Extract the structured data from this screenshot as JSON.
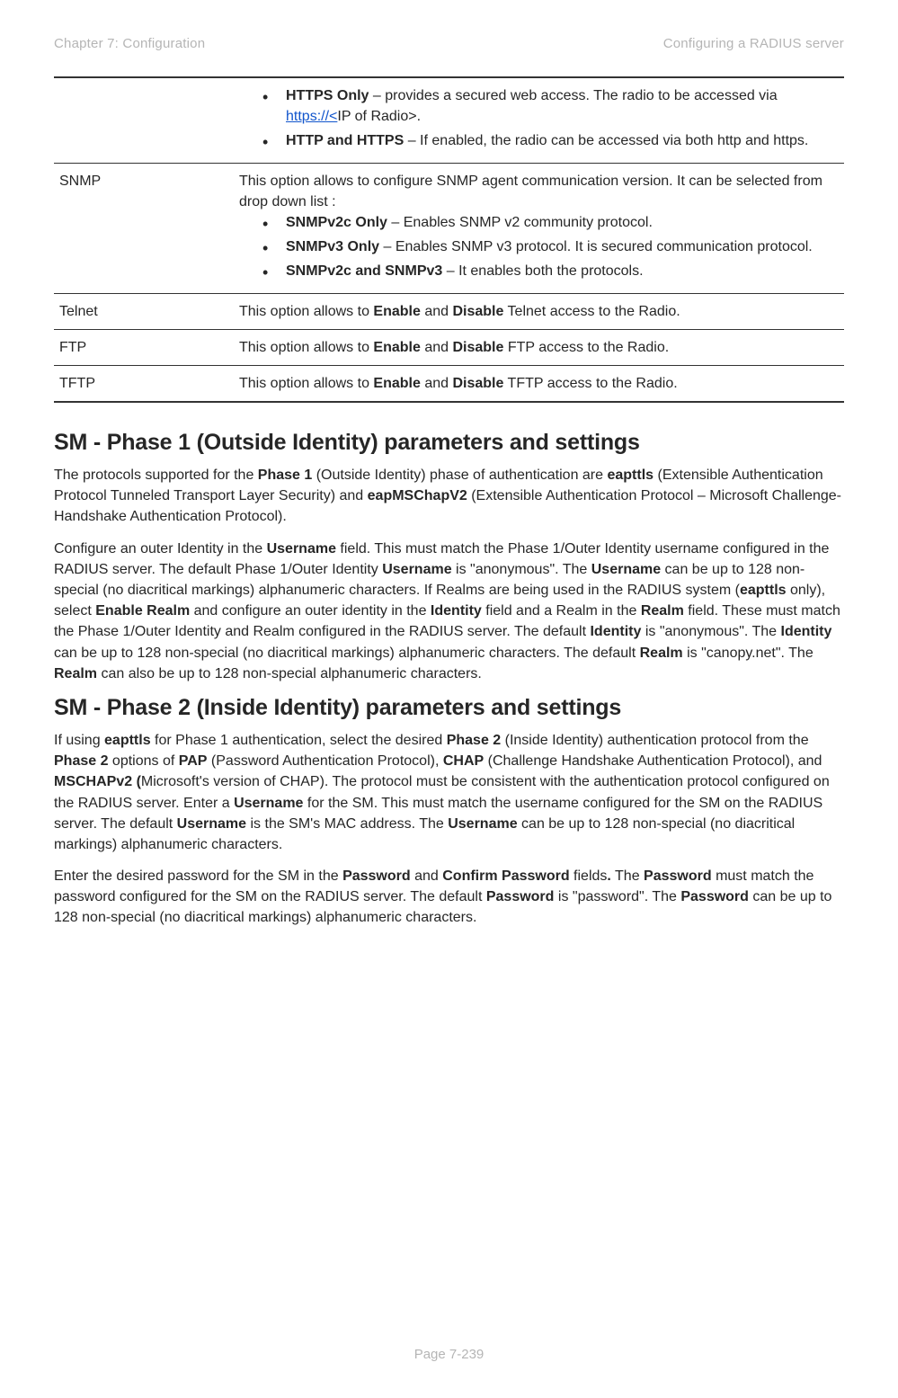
{
  "header": {
    "left": "Chapter 7:  Configuration",
    "right": "Configuring a RADIUS server"
  },
  "table": {
    "row0": {
      "b1_bold": "HTTPS Only",
      "b1_text1": " – provides a secured web access. The radio to be accessed via ",
      "b1_link": "https://<",
      "b1_text2": "IP of Radio>.",
      "b2_bold": "HTTP and HTTPS",
      "b2_text": " – If enabled, the radio can be accessed via both http and https."
    },
    "row1": {
      "label": "SNMP",
      "intro": "This option allows to configure SNMP agent communication version. It can be selected from drop down list :",
      "b1_bold": "SNMPv2c Only",
      "b1_text": " – Enables SNMP v2 community protocol.",
      "b2_bold": "SNMPv3 Only",
      "b2_text": " – Enables SNMP v3 protocol. It is secured communication protocol.",
      "b3_bold": "SNMPv2c and SNMPv3",
      "b3_text": " – It enables both the protocols."
    },
    "row2": {
      "label": "Telnet",
      "t1": "This option allows to ",
      "b1": "Enable",
      "t2": " and ",
      "b2": "Disable",
      "t3": " Telnet access to the Radio."
    },
    "row3": {
      "label": "FTP",
      "t1": "This option allows to ",
      "b1": "Enable",
      "t2": " and ",
      "b2": "Disable",
      "t3": " FTP access to the Radio."
    },
    "row4": {
      "label": "TFTP",
      "t1": "This option allows to ",
      "b1": "Enable",
      "t2": " and ",
      "b2": "Disable",
      "t3": " TFTP access to the Radio."
    }
  },
  "sec1": {
    "heading": "SM - Phase 1 (Outside Identity) parameters and settings",
    "p1_t1": "The protocols supported for the ",
    "p1_b1": "Phase 1",
    "p1_t2": " (Outside Identity) phase of authentication are ",
    "p1_b2": "eapttls",
    "p1_t3": " (Extensible Authentication Protocol Tunneled Transport Layer Security) and ",
    "p1_b3": "eapMSChapV2",
    "p1_t4": " (Extensible Authentication Protocol – Microsoft Challenge-Handshake Authentication Protocol).",
    "p2_t1": "Configure an outer Identity in the ",
    "p2_b1": "Username",
    "p2_t2": " field. This must match the Phase 1/Outer Identity username configured in the RADIUS server. The default Phase 1/Outer Identity ",
    "p2_b2": "Username",
    "p2_t3": " is \"anonymous\". The ",
    "p2_b3": "Username",
    "p2_t4": " can be up to 128 non-special (no diacritical markings) alphanumeric characters. If Realms are being used in the RADIUS system (",
    "p2_b4": "eapttls",
    "p2_t5": " only), select ",
    "p2_b5": "Enable Realm",
    "p2_t6": " and configure an outer identity in the ",
    "p2_b6": "Identity",
    "p2_t7": " field and a Realm in the ",
    "p2_b7": "Realm",
    "p2_t8": " field. These must match the Phase 1/Outer Identity and Realm configured in the RADIUS server. The default ",
    "p2_b8": "Identity",
    "p2_t9": " is \"anonymous\". The ",
    "p2_b9": "Identity",
    "p2_t10": " can be up to 128 non-special (no diacritical markings) alphanumeric characters. The default ",
    "p2_b10": "Realm",
    "p2_t11": " is \"canopy.net\". The ",
    "p2_b11": "Realm",
    "p2_t12": " can also be up to 128 non-special alphanumeric characters."
  },
  "sec2": {
    "heading": "SM - Phase 2 (Inside Identity) parameters and settings",
    "p1_t1": "If using ",
    "p1_b1": "eapttls",
    "p1_t2": " for Phase 1 authentication, select the desired ",
    "p1_b2": "Phase 2",
    "p1_t3": " (Inside Identity) authentication protocol from the ",
    "p1_b3": "Phase 2",
    "p1_t4": " options of ",
    "p1_b4": "PAP",
    "p1_t5": " (Password Authentication Protocol), ",
    "p1_b5": "CHAP",
    "p1_t6": " (Challenge Handshake Authentication Protocol), and ",
    "p1_b6": "MSCHAPv2 (",
    "p1_t7": "Microsoft's version of CHAP). The protocol must be consistent with the authentication protocol configured on the RADIUS server. Enter a ",
    "p1_b7": "Username",
    "p1_t8": " for the SM. This must match the username configured for the SM on the RADIUS server. The default ",
    "p1_b8": "Username",
    "p1_t9": " is the SM's MAC address. The ",
    "p1_b9": "Username",
    "p1_t10": " can be up to 128 non-special (no diacritical markings) alphanumeric characters.",
    "p2_t1": "Enter the desired password for the SM in the ",
    "p2_b1": "Password",
    "p2_t2": " and ",
    "p2_b2": "Confirm Password",
    "p2_t3": " fields",
    "p2_b3": ".",
    "p2_t4": " The ",
    "p2_b4": "Password",
    "p2_t5": " must match the password configured for the SM on the RADIUS server. The default ",
    "p2_b5": "Password",
    "p2_t6": " is \"password\". The ",
    "p2_b6": "Password",
    "p2_t7": " can be up to 128 non-special (no diacritical markings) alphanumeric characters."
  },
  "footer": "Page 7-239"
}
